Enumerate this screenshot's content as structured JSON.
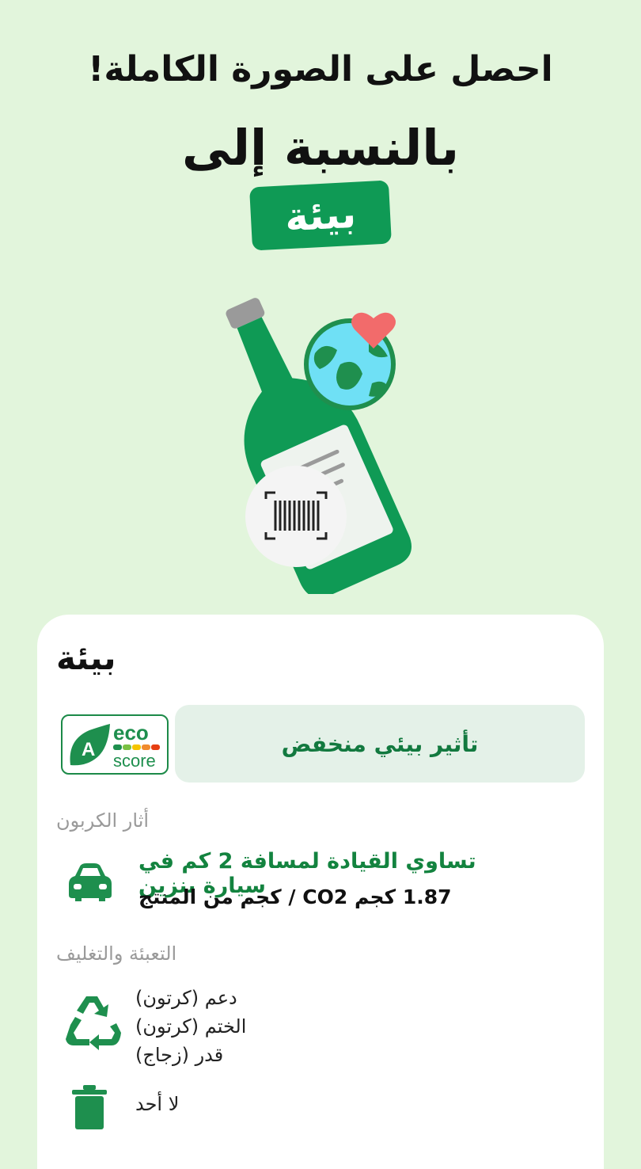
{
  "header": {
    "line1": "احصل على الصورة الكاملة!",
    "line2": "بالنسبة إلى",
    "tag": "بيئة"
  },
  "card": {
    "title": "بيئة",
    "eco_score": {
      "grade": "A",
      "word1": "eco",
      "word2": "score",
      "colors": [
        "#1e8f4e",
        "#7ac143",
        "#f5c400",
        "#f08b2e",
        "#e63e11"
      ]
    },
    "impact_label": "تأثير بيئي منخفض",
    "carbon": {
      "section_label": "أثار الكربون",
      "icon": "car-icon",
      "equivalent": "تساوي القيادة لمسافة 2 كم في سيارة بنزين",
      "value": "1.87 كجم CO2 / كجم من المنتج"
    },
    "packaging": {
      "section_label": "التعبئة والتغليف",
      "icon": "recycle-icon",
      "items": [
        "دعم (كرتون)",
        "الختم (كرتون)",
        "قدر (زجاج)"
      ],
      "waste_icon": "trash-icon",
      "waste_label": "لا أحد"
    }
  },
  "colors": {
    "background": "#e2f5dc",
    "brand_green": "#0f9a55",
    "text_green": "#13833f"
  }
}
